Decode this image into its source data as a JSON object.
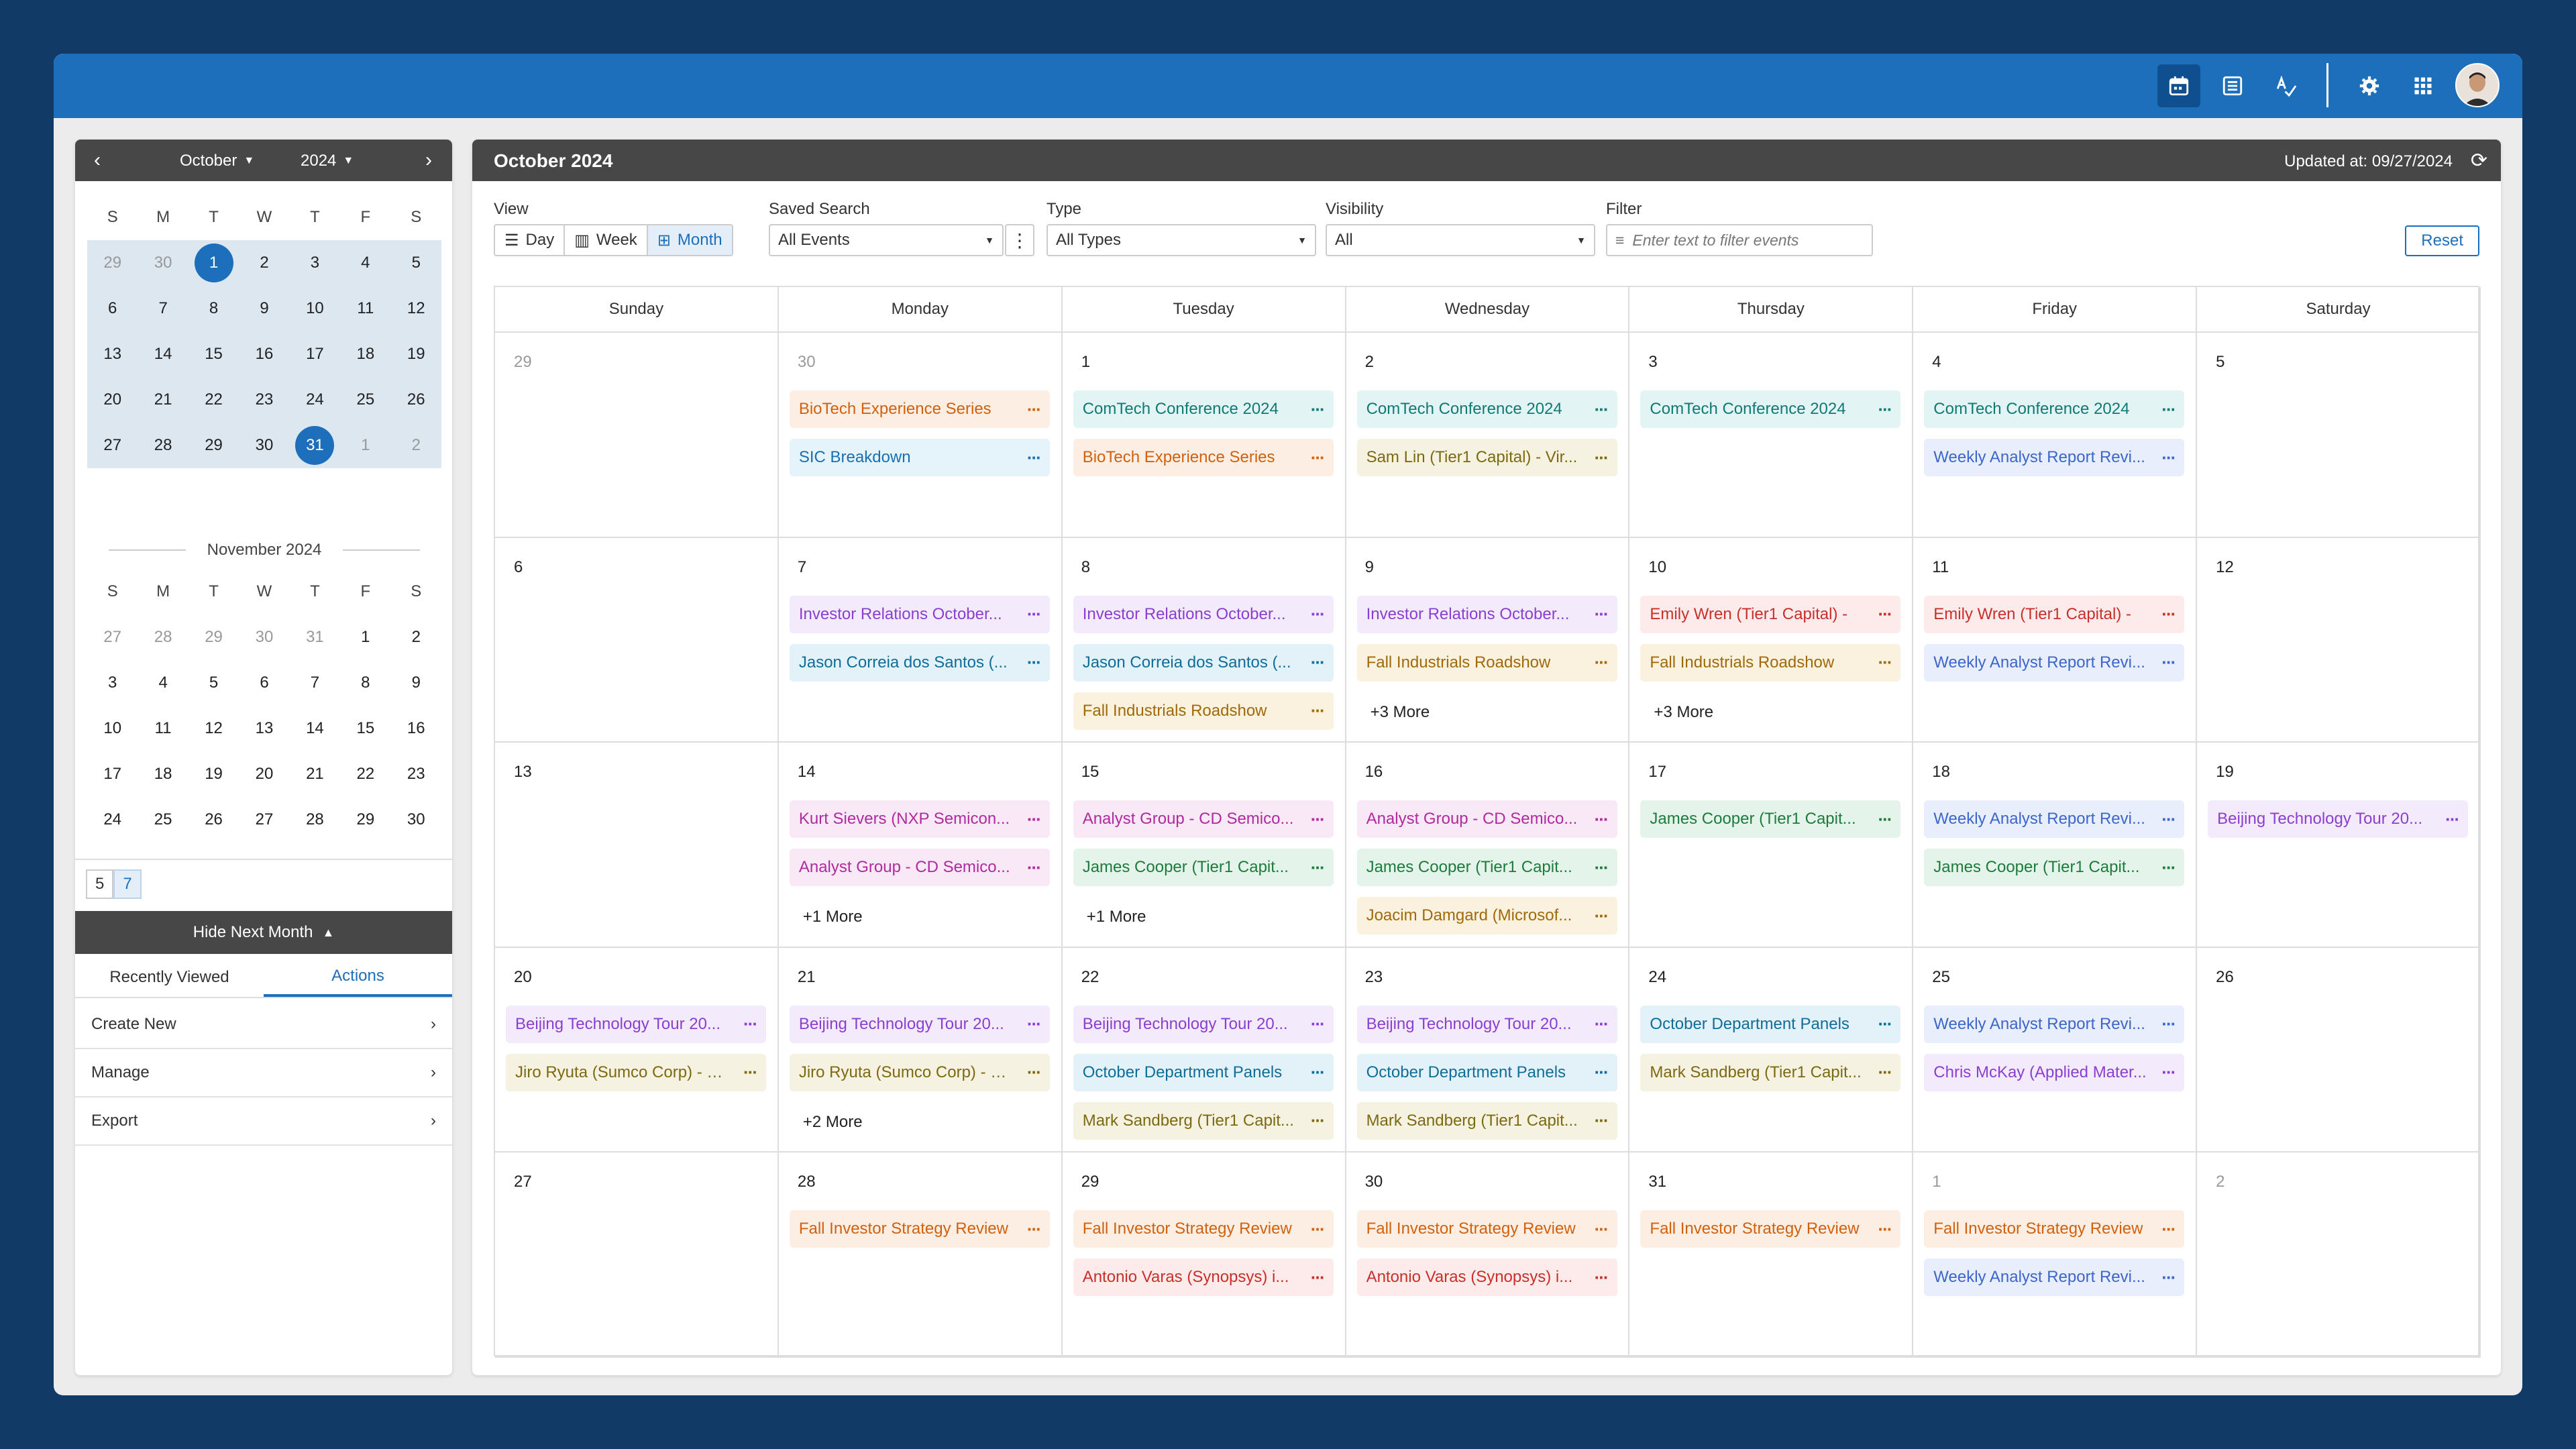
{
  "topbar": {
    "icons": [
      "calendar-icon",
      "list-icon",
      "spellcheck-icon",
      "gear-icon",
      "apps-grid-icon"
    ],
    "accent": "#1d6fbb"
  },
  "minical": {
    "month": "October",
    "year": "2024",
    "prev": "‹",
    "next": "›",
    "weekdays": [
      "S",
      "M",
      "T",
      "W",
      "T",
      "F",
      "S"
    ],
    "october": [
      [
        "29",
        "30",
        "1",
        "2",
        "3",
        "4",
        "5"
      ],
      [
        "6",
        "7",
        "8",
        "9",
        "10",
        "11",
        "12"
      ],
      [
        "13",
        "14",
        "15",
        "16",
        "17",
        "18",
        "19"
      ],
      [
        "20",
        "21",
        "22",
        "23",
        "24",
        "25",
        "26"
      ],
      [
        "27",
        "28",
        "29",
        "30",
        "31",
        "1",
        "2"
      ]
    ],
    "next_title": "November 2024",
    "november": [
      [
        "27",
        "28",
        "29",
        "30",
        "31",
        "1",
        "2"
      ],
      [
        "3",
        "4",
        "5",
        "6",
        "7",
        "8",
        "9"
      ],
      [
        "10",
        "11",
        "12",
        "13",
        "14",
        "15",
        "16"
      ],
      [
        "17",
        "18",
        "19",
        "20",
        "21",
        "22",
        "23"
      ],
      [
        "24",
        "25",
        "26",
        "27",
        "28",
        "29",
        "30"
      ]
    ],
    "chips": [
      "5",
      "7"
    ],
    "hide_label": "Hide Next Month"
  },
  "left_tabs": [
    "Recently Viewed",
    "Actions"
  ],
  "actions": [
    "Create New",
    "Manage",
    "Export"
  ],
  "main": {
    "title": "October 2024",
    "updated": "Updated at: 09/27/2024",
    "view_label": "View",
    "views": [
      "Day",
      "Week",
      "Month"
    ],
    "saved_search_label": "Saved Search",
    "saved_search_value": "All Events",
    "type_label": "Type",
    "type_value": "All Types",
    "visibility_label": "Visibility",
    "visibility_value": "All",
    "filter_label": "Filter",
    "filter_placeholder": "Enter text to filter events",
    "reset": "Reset"
  },
  "calendar": {
    "days": [
      "Sunday",
      "Monday",
      "Tuesday",
      "Wednesday",
      "Thursday",
      "Friday",
      "Saturday"
    ],
    "weeks": [
      [
        {
          "d": "29",
          "other": true,
          "ev": []
        },
        {
          "d": "30",
          "other": true,
          "ev": [
            [
              "BioTech Experience Series",
              "orange"
            ],
            [
              "SIC Breakdown",
              "blue"
            ]
          ]
        },
        {
          "d": "1",
          "ev": [
            [
              "ComTech Conference 2024",
              "teal"
            ],
            [
              "BioTech Experience Series",
              "orange"
            ]
          ]
        },
        {
          "d": "2",
          "ev": [
            [
              "ComTech Conference 2024",
              "teal"
            ],
            [
              "Sam Lin (Tier1 Capital) - Vir...",
              "olive"
            ]
          ]
        },
        {
          "d": "3",
          "ev": [
            [
              "ComTech Conference 2024",
              "teal"
            ]
          ]
        },
        {
          "d": "4",
          "ev": [
            [
              "ComTech Conference 2024",
              "teal"
            ],
            [
              "Weekly Analyst Report Revi...",
              "periw"
            ]
          ]
        },
        {
          "d": "5",
          "ev": []
        }
      ],
      [
        {
          "d": "6",
          "ev": []
        },
        {
          "d": "7",
          "ev": [
            [
              "Investor Relations October...",
              "purple"
            ],
            [
              "Jason Correia dos Santos (...",
              "tblue"
            ]
          ]
        },
        {
          "d": "8",
          "ev": [
            [
              "Investor Relations October...",
              "purple"
            ],
            [
              "Jason Correia dos Santos (...",
              "tblue"
            ],
            [
              "Fall Industrials Roadshow",
              "gold"
            ]
          ]
        },
        {
          "d": "9",
          "ev": [
            [
              "Investor Relations October...",
              "purple"
            ],
            [
              "Fall Industrials Roadshow",
              "gold"
            ]
          ],
          "more": "+3 More"
        },
        {
          "d": "10",
          "ev": [
            [
              "Emily Wren (Tier1 Capital) -",
              "red"
            ],
            [
              "Fall Industrials Roadshow",
              "gold"
            ]
          ],
          "more": "+3 More"
        },
        {
          "d": "11",
          "ev": [
            [
              "Emily Wren (Tier1 Capital) -",
              "red"
            ],
            [
              "Weekly Analyst Report Revi...",
              "periw"
            ]
          ]
        },
        {
          "d": "12",
          "ev": []
        }
      ],
      [
        {
          "d": "13",
          "ev": []
        },
        {
          "d": "14",
          "ev": [
            [
              "Kurt Sievers (NXP Semicon...",
              "magenta"
            ],
            [
              "Analyst Group - CD Semico...",
              "magenta"
            ]
          ],
          "more": "+1 More"
        },
        {
          "d": "15",
          "ev": [
            [
              "Analyst Group - CD Semico...",
              "magenta"
            ],
            [
              "James Cooper (Tier1 Capit...",
              "green"
            ]
          ],
          "more": "+1 More"
        },
        {
          "d": "16",
          "ev": [
            [
              "Analyst Group - CD Semico...",
              "magenta"
            ],
            [
              "James Cooper (Tier1 Capit...",
              "green"
            ],
            [
              "Joacim Damgard (Microsof...",
              "gold"
            ]
          ]
        },
        {
          "d": "17",
          "ev": [
            [
              "James Cooper (Tier1 Capit...",
              "green"
            ]
          ]
        },
        {
          "d": "18",
          "ev": [
            [
              "Weekly Analyst Report Revi...",
              "periw"
            ],
            [
              "James Cooper (Tier1 Capit...",
              "green"
            ]
          ]
        },
        {
          "d": "19",
          "ev": [
            [
              "Beijing Technology Tour 20...",
              "purple"
            ]
          ]
        }
      ],
      [
        {
          "d": "20",
          "ev": [
            [
              "Beijing Technology Tour 20...",
              "purple"
            ],
            [
              "Jiro Ryuta (Sumco Corp) - O...",
              "olive"
            ]
          ]
        },
        {
          "d": "21",
          "ev": [
            [
              "Beijing Technology Tour 20...",
              "purple"
            ],
            [
              "Jiro Ryuta (Sumco Corp) - O...",
              "olive"
            ]
          ],
          "more": "+2 More"
        },
        {
          "d": "22",
          "ev": [
            [
              "Beijing Technology Tour 20...",
              "purple"
            ],
            [
              "October Department Panels",
              "tblue"
            ],
            [
              "Mark Sandberg (Tier1 Capit...",
              "olive"
            ]
          ]
        },
        {
          "d": "23",
          "ev": [
            [
              "Beijing Technology Tour 20...",
              "purple"
            ],
            [
              "October Department Panels",
              "tblue"
            ],
            [
              "Mark Sandberg (Tier1 Capit...",
              "olive"
            ]
          ]
        },
        {
          "d": "24",
          "ev": [
            [
              "October Department Panels",
              "tblue"
            ],
            [
              "Mark Sandberg (Tier1 Capit...",
              "olive"
            ]
          ]
        },
        {
          "d": "25",
          "ev": [
            [
              "Weekly Analyst Report Revi...",
              "periw"
            ],
            [
              "Chris McKay (Applied Mater...",
              "purple"
            ]
          ]
        },
        {
          "d": "26",
          "ev": []
        }
      ],
      [
        {
          "d": "27",
          "ev": []
        },
        {
          "d": "28",
          "ev": [
            [
              "Fall Investor Strategy Review",
              "orange"
            ]
          ]
        },
        {
          "d": "29",
          "ev": [
            [
              "Fall Investor Strategy Review",
              "orange"
            ],
            [
              "Antonio Varas (Synopsys) i...",
              "red"
            ]
          ]
        },
        {
          "d": "30",
          "ev": [
            [
              "Fall Investor Strategy Review",
              "orange"
            ],
            [
              "Antonio Varas (Synopsys) i...",
              "red"
            ]
          ]
        },
        {
          "d": "31",
          "ev": [
            [
              "Fall Investor Strategy Review",
              "orange"
            ]
          ]
        },
        {
          "d": "1",
          "other": true,
          "ev": [
            [
              "Fall Investor Strategy Review",
              "orange"
            ],
            [
              "Weekly Analyst Report Revi...",
              "periw"
            ]
          ]
        },
        {
          "d": "2",
          "other": true,
          "ev": []
        }
      ]
    ]
  }
}
